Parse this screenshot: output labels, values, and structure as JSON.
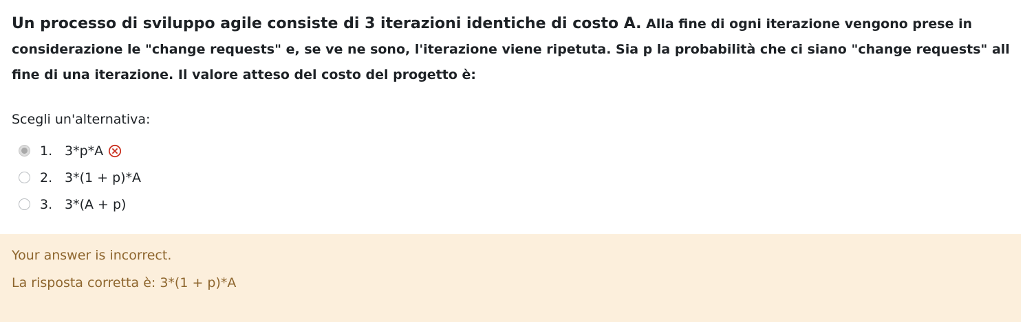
{
  "question": {
    "lead": "Un processo di sviluppo agile consiste di 3 iterazioni identiche di costo A.",
    "body": " Alla fine di ogni iterazione vengono prese in considerazione le \"change requests\" e, se ve ne sono, l'iterazione viene ripetuta. Sia p la probabilità che ci siano \"change requests\" all fine di una iterazione. Il valore atteso del costo del progetto è:"
  },
  "prompt": "Scegli un'alternativa:",
  "answers": [
    {
      "number": "1.",
      "text": "3*p*A",
      "selected": true,
      "marked_incorrect": true
    },
    {
      "number": "2.",
      "text": "3*(1 + p)*A",
      "selected": false
    },
    {
      "number": "3.",
      "text": "3*(A + p)",
      "selected": false
    }
  ],
  "feedback": {
    "status": "Your answer is incorrect.",
    "correct_answer": "La risposta corretta è: 3*(1 + p)*A"
  },
  "colors": {
    "feedback_background": "#fcefdc",
    "feedback_text": "#8e662e",
    "incorrect_icon": "#ca3120"
  },
  "icons": {
    "incorrect": "circle-x-icon"
  }
}
